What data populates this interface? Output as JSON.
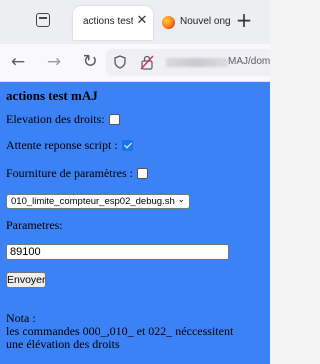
{
  "browser": {
    "active_tab": {
      "title": "actions test m",
      "close": "✕"
    },
    "second_tab": {
      "title": "Nouvel ong"
    },
    "new_tab": "+",
    "nav": {
      "back": "←",
      "forward": "→",
      "reload": "↻"
    },
    "url_visible": "MAJ/domotic"
  },
  "page": {
    "heading": "actions test mAJ",
    "elevation": {
      "label": "Elevation des droits:",
      "checked": false
    },
    "attente": {
      "label": "Attente reponse script :",
      "checked": true
    },
    "fourniture": {
      "label": "Fourniture de paramètres :",
      "checked": false
    },
    "script_select": {
      "selected": "010_limite_compteur_esp02_debug.sh"
    },
    "parametres": {
      "label": "Parametres:",
      "value": "89100"
    },
    "send_button": "Envoyer",
    "note": {
      "title": "Nota :",
      "line1": "les commandes 000_,010_ et 022_ néccessitent",
      "line2": "une élévation des droits"
    }
  },
  "colors": {
    "page_background": "#3b82f6",
    "checkbox_checked": "#1a73e8"
  }
}
